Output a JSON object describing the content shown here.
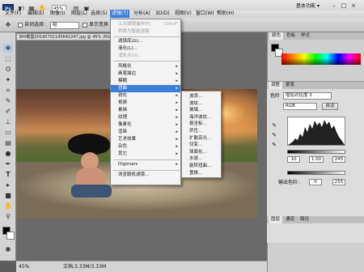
{
  "menubar": {
    "logo": "Ps",
    "zoom": "45%",
    "items": [
      "文件(F)",
      "编辑(E)",
      "图像(I)",
      "图层(L)",
      "选择(S)",
      "滤镜(T)",
      "分析(A)",
      "3D(D)",
      "视图(V)",
      "窗口(W)",
      "帮助(H)"
    ],
    "workspace": "基本功能",
    "workspace_arrow": "▾"
  },
  "options": {
    "auto_select_label": "自动选择:",
    "auto_select_value": "组",
    "show_transform_label": "显示变换"
  },
  "document": {
    "tab": "360截图20190702145642247.jpg @ 45% (RGB/8)",
    "zoom": "45%",
    "doc_size": "文档:3.33M/3.33M"
  },
  "panels": {
    "color_tabs": [
      "颜色",
      "色板",
      "样式"
    ],
    "adjust_tabs": [
      "调整",
      "蒙版"
    ],
    "levels_title": "色阶",
    "preset": "增加对比度 3",
    "channel": "RGB",
    "auto_button": "自动",
    "input_values": [
      "10",
      "1.00",
      "245"
    ],
    "output_label": "输出色阶:",
    "output_values": [
      "0",
      "255"
    ],
    "bottom_tabs": [
      "图层",
      "通道",
      "路径"
    ]
  },
  "filter_menu": {
    "items": [
      {
        "label": "上次滤镜操作(F)",
        "shortcut": "Ctrl+F",
        "grey": true
      },
      {
        "label": "转换为智能滤镜",
        "grey": true
      },
      {
        "label": "滤镜库(G)...",
        "grey": false
      },
      {
        "label": "液化(L)...",
        "grey": false
      },
      {
        "label": "消失点(V)...",
        "grey": true
      },
      {
        "label": "风格化",
        "sub": true
      },
      {
        "label": "画笔描边",
        "sub": true
      },
      {
        "label": "模糊",
        "sub": true
      },
      {
        "label": "扭曲",
        "sub": true,
        "highlight": true
      },
      {
        "label": "锐化",
        "sub": true
      },
      {
        "label": "视频",
        "sub": true
      },
      {
        "label": "素描",
        "sub": true
      },
      {
        "label": "纹理",
        "sub": true
      },
      {
        "label": "像素化",
        "sub": true
      },
      {
        "label": "渲染",
        "sub": true
      },
      {
        "label": "艺术效果",
        "sub": true
      },
      {
        "label": "杂色",
        "sub": true
      },
      {
        "label": "其它",
        "sub": true
      },
      {
        "label": "Digimarc",
        "sub": true
      },
      {
        "label": "浏览联机滤镜...",
        "grey": false
      }
    ]
  },
  "distort_menu": {
    "items": [
      "波浪...",
      "波纹...",
      "玻璃...",
      "海洋波纹...",
      "极坐标...",
      "挤压...",
      "扩散亮光...",
      "切变...",
      "球面化...",
      "水波...",
      "旋转扭曲...",
      "置换..."
    ]
  },
  "icons": {
    "move": "✥",
    "marquee": "⬚",
    "lasso": "ʘ",
    "wand": "✦",
    "crop": "⌗",
    "eyedropper": "✎",
    "brush": "✐",
    "stamp": "⊥",
    "eraser": "▭",
    "gradient": "▤",
    "dodge": "●",
    "pen": "✒",
    "type": "T",
    "path": "▸",
    "shape": "■",
    "hand": "✋",
    "zoom": "⚲",
    "minimize": "–",
    "maximize": "□",
    "close": "×",
    "submenu": "▸"
  }
}
